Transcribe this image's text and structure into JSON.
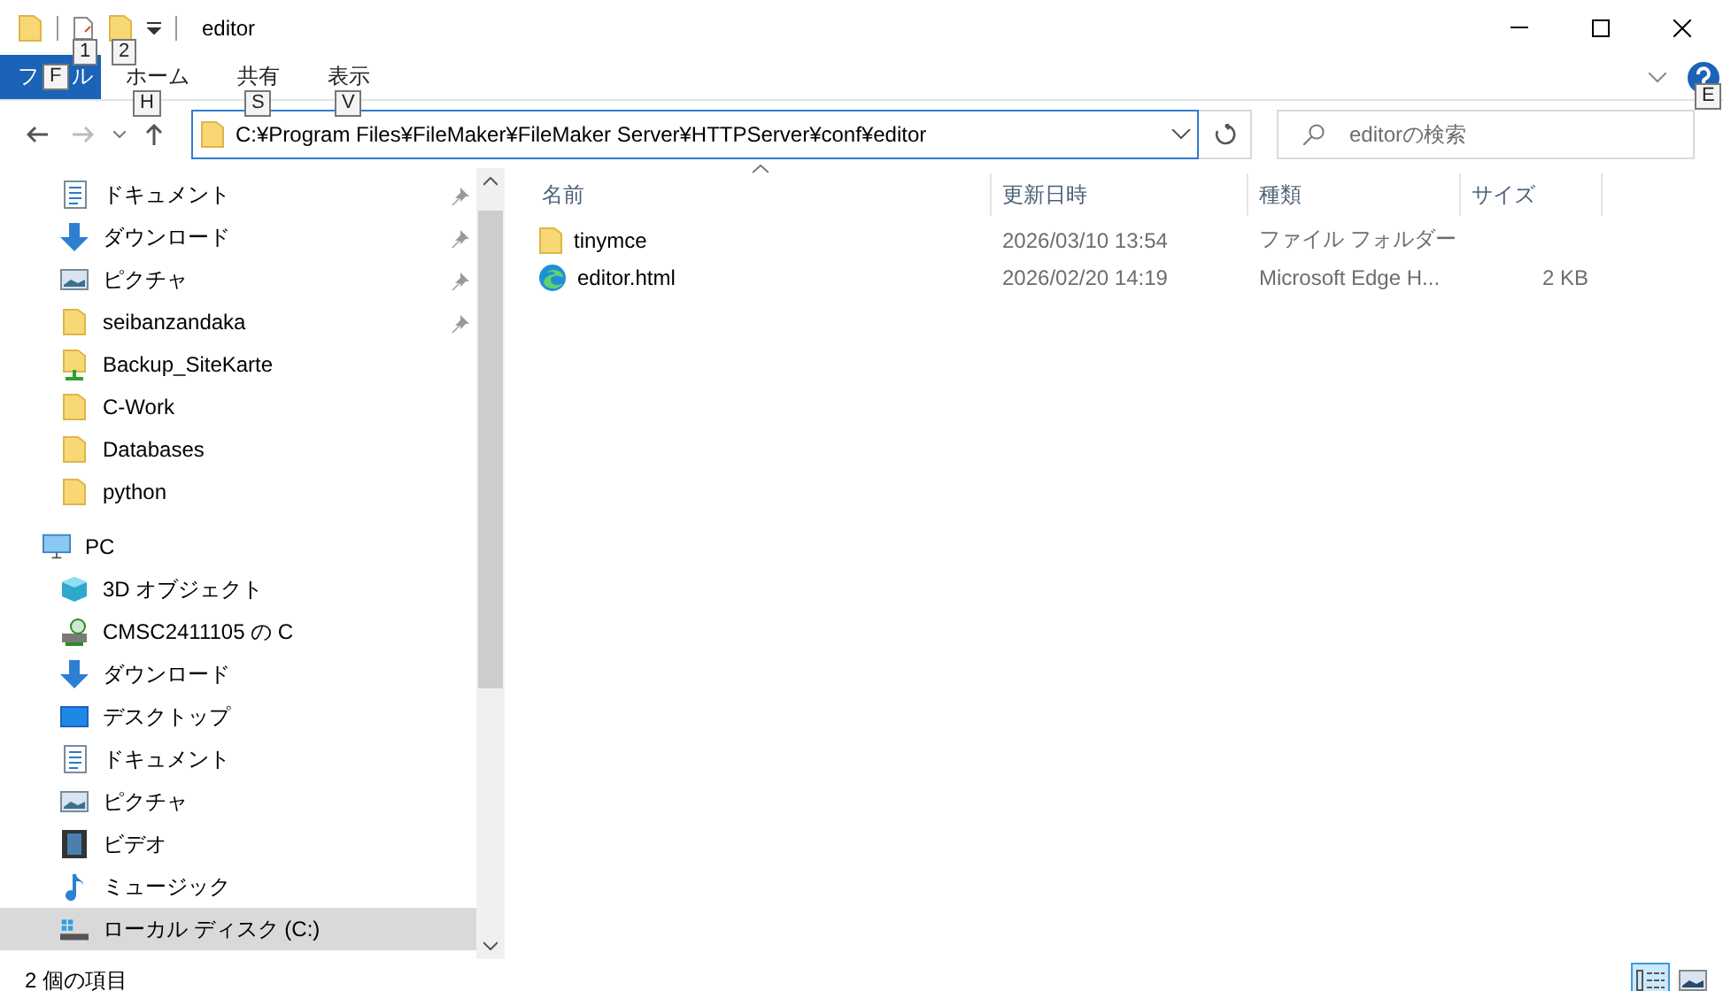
{
  "window": {
    "title": "editor"
  },
  "quick_access_keytips": [
    "1",
    "2"
  ],
  "ribbon": {
    "file_tab": {
      "label_start": "フ",
      "keytip": "F",
      "label_end": "ル"
    },
    "tabs": [
      {
        "label": "ホーム",
        "keytip": "H",
        "selected": false
      },
      {
        "label": "共有",
        "keytip": "S",
        "selected": false
      },
      {
        "label": "表示",
        "keytip": "V",
        "selected": false
      }
    ],
    "help_keytip": "E"
  },
  "address": {
    "path": "C:¥Program Files¥FileMaker¥FileMaker Server¥HTTPServer¥conf¥editor"
  },
  "search": {
    "placeholder": "editorの検索"
  },
  "nav_items": [
    {
      "label": "ドキュメント",
      "kind": "document",
      "pinned": true,
      "selected": false
    },
    {
      "label": "ダウンロード",
      "kind": "download",
      "pinned": true,
      "selected": false
    },
    {
      "label": "ピクチャ",
      "kind": "picture",
      "pinned": true,
      "selected": false
    },
    {
      "label": "seibanzandaka",
      "kind": "folder",
      "pinned": true,
      "selected": false
    },
    {
      "label": "Backup_SiteKarte",
      "kind": "shared-folder",
      "pinned": false,
      "selected": false
    },
    {
      "label": "C-Work",
      "kind": "folder",
      "pinned": false,
      "selected": false
    },
    {
      "label": "Databases",
      "kind": "folder",
      "pinned": false,
      "selected": false
    },
    {
      "label": "python",
      "kind": "folder",
      "pinned": false,
      "selected": false
    }
  ],
  "pc": {
    "label": "PC",
    "kind": "pc",
    "selected": false,
    "children": [
      {
        "label": "3D オブジェクト",
        "kind": "cube",
        "selected": false
      },
      {
        "label": "CMSC2411105 の C",
        "kind": "network-drive",
        "selected": false
      },
      {
        "label": "ダウンロード",
        "kind": "download",
        "selected": false
      },
      {
        "label": "デスクトップ",
        "kind": "desktop",
        "selected": false
      },
      {
        "label": "ドキュメント",
        "kind": "document",
        "selected": false
      },
      {
        "label": "ピクチャ",
        "kind": "picture",
        "selected": false
      },
      {
        "label": "ビデオ",
        "kind": "video",
        "selected": false
      },
      {
        "label": "ミュージック",
        "kind": "music",
        "selected": false
      },
      {
        "label": "ローカル ディスク (C:)",
        "kind": "drive",
        "selected": true
      }
    ]
  },
  "table": {
    "columns": [
      "名前",
      "更新日時",
      "種類",
      "サイズ"
    ],
    "rows": [
      {
        "kind": "folder",
        "name": "tinymce",
        "modified": "2026/03/10 13:54",
        "type": "ファイル フォルダー",
        "selected": false
      },
      {
        "kind": "edge",
        "name": "editor.html",
        "modified": "2026/02/20 14:19",
        "type": "Microsoft Edge H...",
        "size": "2 KB",
        "selected": false
      }
    ]
  },
  "status_bar": {
    "item_count": "2 個の項目",
    "view_buttons": [
      {
        "kind": "details",
        "selected": true
      },
      {
        "kind": "large-icons",
        "selected": false
      }
    ]
  }
}
